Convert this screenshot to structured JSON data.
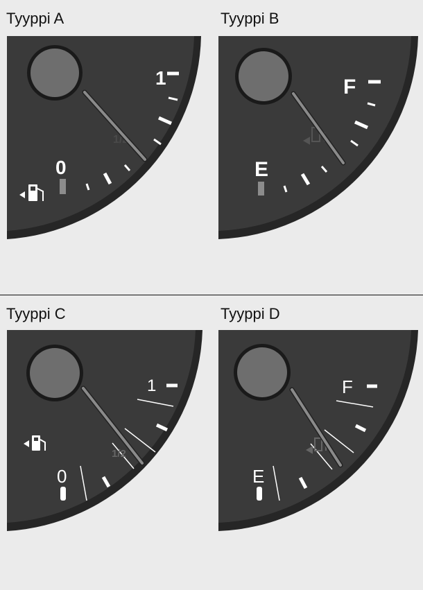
{
  "panels": [
    {
      "id": "a",
      "title": "Tyyppi A",
      "empty": "0",
      "half": "1/2",
      "full": "1"
    },
    {
      "id": "b",
      "title": "Tyyppi B",
      "empty": "E",
      "full": "F"
    },
    {
      "id": "c",
      "title": "Tyyppi C",
      "empty": "0",
      "half": "1/2",
      "full": "1"
    },
    {
      "id": "d",
      "title": "Tyyppi D",
      "empty": "E",
      "full": "F"
    }
  ],
  "colors": {
    "dial": "#3a3a3a",
    "bezel": "#262626",
    "hub": "#6e6e6e",
    "needle": "#8a8a8a",
    "low_fuel_mark": "#8c8c8c",
    "tick": "#ffffff"
  },
  "icons": [
    "fuel-pump-icon",
    "fuel-cap-side-arrow-icon"
  ]
}
